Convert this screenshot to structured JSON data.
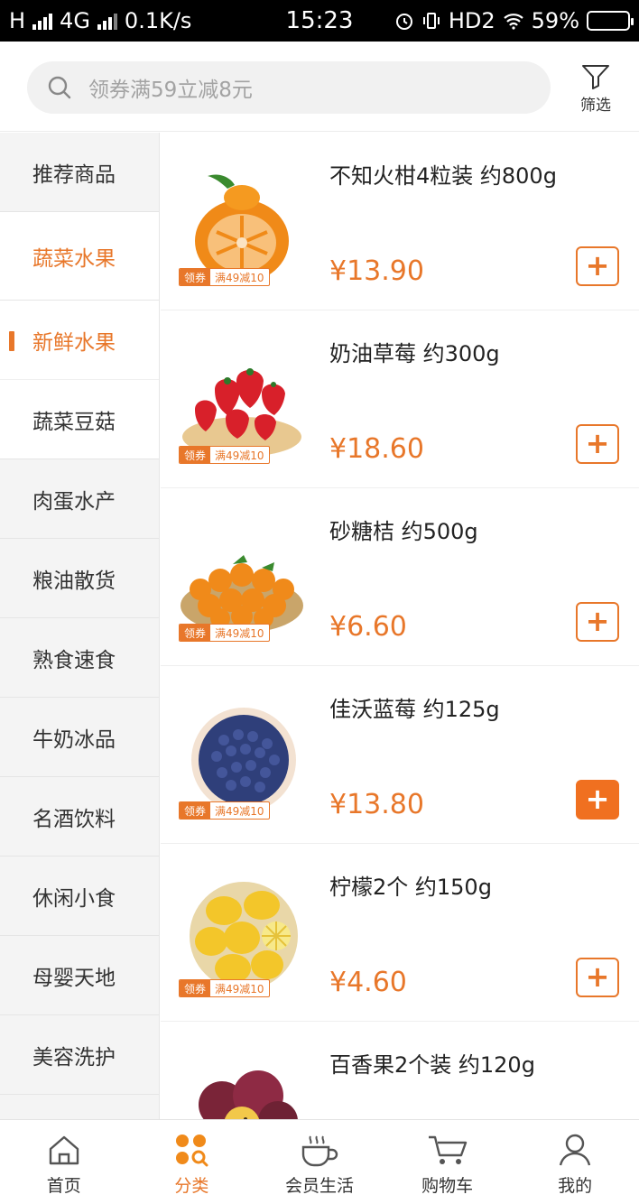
{
  "status_bar": {
    "carrier_signal": "H",
    "network": "4G",
    "speed": "0.1K/s",
    "time": "15:23",
    "hd": "HD2",
    "battery": "59%",
    "battery_level": 0.59
  },
  "search": {
    "placeholder": "领券满59立减8元",
    "filter_label": "筛选"
  },
  "sidebar": {
    "items": [
      {
        "label": "推荐商品"
      },
      {
        "label": "蔬菜水果"
      },
      {
        "label": "新鲜水果"
      },
      {
        "label": "蔬菜豆菇"
      },
      {
        "label": "肉蛋水产"
      },
      {
        "label": "粮油散货"
      },
      {
        "label": "熟食速食"
      },
      {
        "label": "牛奶冰品"
      },
      {
        "label": "名酒饮料"
      },
      {
        "label": "休闲小食"
      },
      {
        "label": "母婴天地"
      },
      {
        "label": "美容洗护"
      }
    ]
  },
  "coupon": {
    "tag": "领券",
    "text": "满49减10"
  },
  "products": [
    {
      "name": "不知火柑4粒装 约800g",
      "price": "¥13.90"
    },
    {
      "name": "奶油草莓 约300g",
      "price": "¥18.60"
    },
    {
      "name": "砂糖桔 约500g",
      "price": "¥6.60"
    },
    {
      "name": "佳沃蓝莓 约125g",
      "price": "¥13.80"
    },
    {
      "name": "柠檬2个 约150g",
      "price": "¥4.60"
    },
    {
      "name": "百香果2个装 约120g",
      "price": ""
    }
  ],
  "add_label": "+",
  "colors": {
    "accent": "#e8772a"
  },
  "tabbar": {
    "items": [
      {
        "label": "首页",
        "icon": "home-icon"
      },
      {
        "label": "分类",
        "icon": "category-icon"
      },
      {
        "label": "会员生活",
        "icon": "coffee-icon"
      },
      {
        "label": "购物车",
        "icon": "cart-icon"
      },
      {
        "label": "我的",
        "icon": "profile-icon"
      }
    ]
  }
}
